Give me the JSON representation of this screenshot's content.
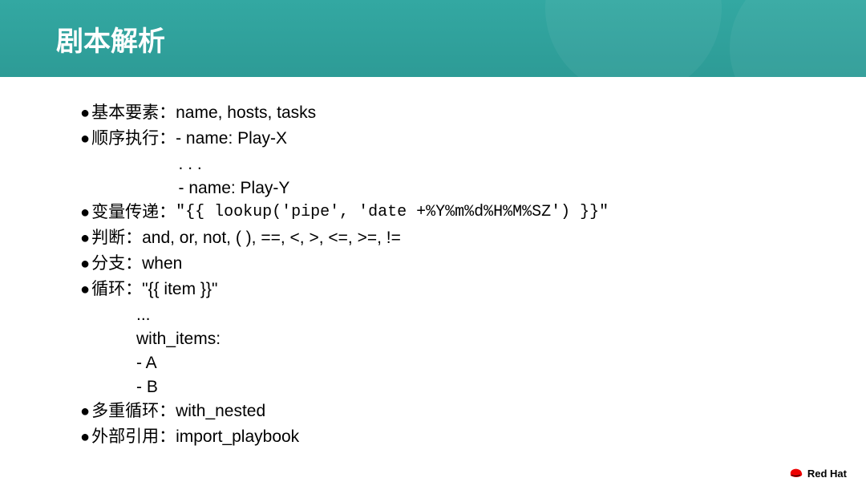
{
  "header": {
    "title": "剧本解析"
  },
  "items": [
    {
      "label": "基本要素：",
      "value": "name, hosts, tasks",
      "sub": []
    },
    {
      "label": "顺序执行：",
      "value": "- name: Play-X",
      "sub": [
        "                     . . .",
        "                     - name: Play-Y"
      ]
    },
    {
      "label": "变量传递：",
      "value": "\"{{ lookup('pipe', 'date +%Y%m%d%H%M%SZ') }}\"",
      "mono": true,
      "sub": []
    },
    {
      "label": "判断：",
      "value": "and, or, not, ( ), ==, <, >, <=, >=, !=",
      "sub": []
    },
    {
      "label": "分支：",
      "value": "when",
      "sub": []
    },
    {
      "label": "循环：",
      "value": "\"{{ item }}\"",
      "sub": [
        "            ...",
        "            with_items:",
        "            - A",
        "            - B"
      ]
    },
    {
      "label": "多重循环：",
      "value": "with_nested",
      "sub": []
    },
    {
      "label": "外部引用：",
      "value": "import_playbook",
      "sub": []
    }
  ],
  "footer": {
    "brand": "Red Hat"
  }
}
